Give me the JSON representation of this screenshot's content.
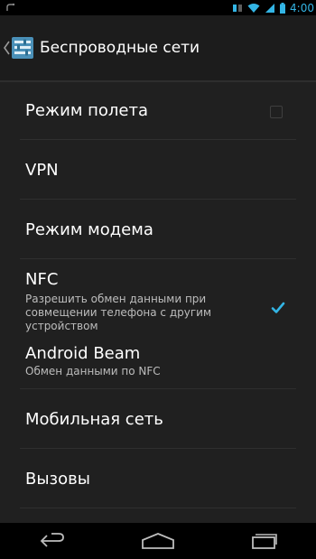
{
  "status_bar": {
    "time": "4:00",
    "icons": [
      "notification-icon",
      "sync-icon",
      "wifi-icon",
      "signal-icon",
      "battery-icon"
    ]
  },
  "action_bar": {
    "title": "Беспроводные сети",
    "icon": "settings-app-icon"
  },
  "items": {
    "airplane": {
      "label": "Режим полета",
      "checked": false
    },
    "vpn": {
      "label": "VPN"
    },
    "tethering": {
      "label": "Режим модема"
    },
    "nfc": {
      "label": "NFC",
      "summary_line1": "Разрешить обмен данными при",
      "summary_line2": "совмещении телефона с другим",
      "summary_line3": "устройством",
      "checked": true
    },
    "beam": {
      "label": "Android Beam",
      "summary": "Обмен данными по NFC"
    },
    "mobile": {
      "label": "Мобильная сеть"
    },
    "calls": {
      "label": "Вызовы"
    }
  },
  "nav_bar": {
    "buttons": [
      "back-icon",
      "home-icon",
      "recent-apps-icon"
    ]
  },
  "colors": {
    "accent": "#33b5e5",
    "background": "#202020",
    "divider": "#2f2f2f"
  }
}
